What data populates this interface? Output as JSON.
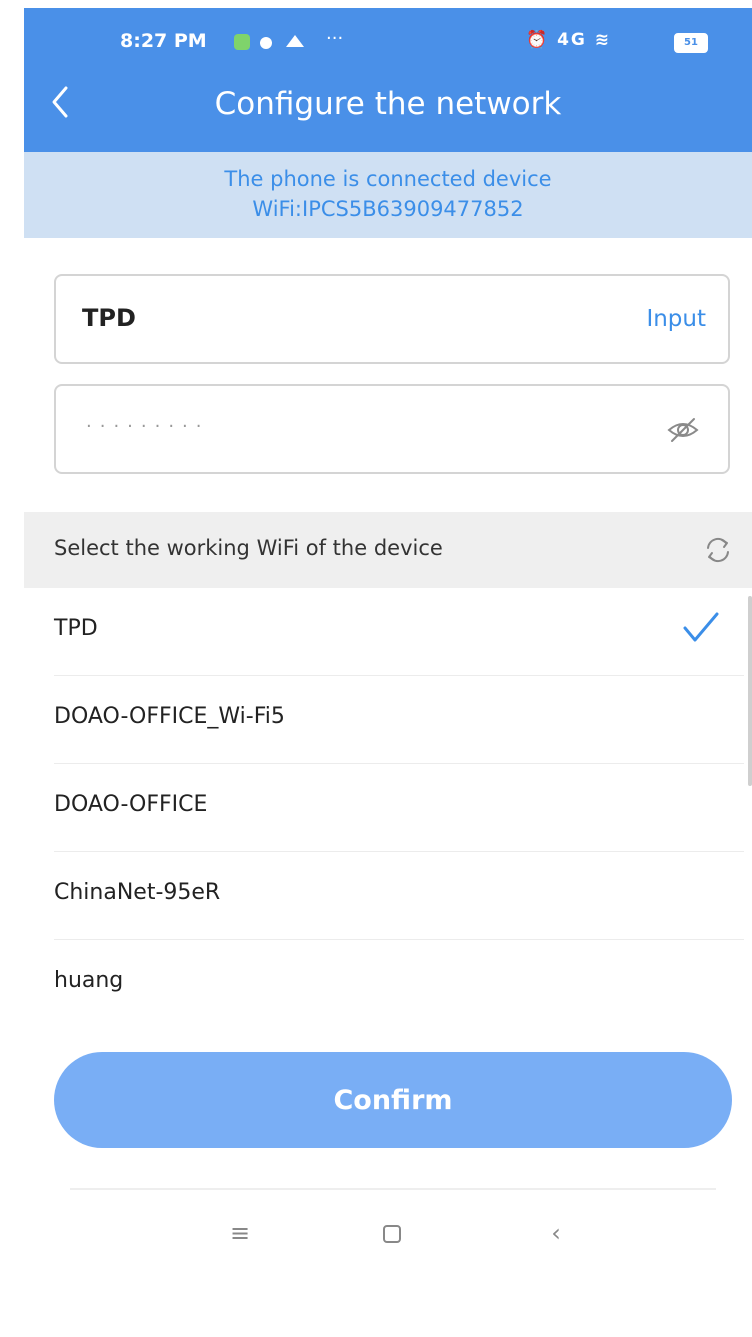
{
  "status_bar": {
    "time": "8:27 PM",
    "more": "···",
    "right_icons": "⏰ 4G ≋",
    "battery": "51"
  },
  "header": {
    "title": "Configure the network"
  },
  "banner": {
    "line1": "The phone is connected device",
    "line2": "WiFi:IPCS5B63909477852"
  },
  "form": {
    "ssid_value": "TPD",
    "ssid_action": "Input",
    "password_mask": "·········"
  },
  "wifi_section": {
    "label": "Select the working WiFi of the device"
  },
  "wifi_list": [
    {
      "name": "TPD",
      "selected": true
    },
    {
      "name": "DOAO-OFFICE_Wi-Fi5",
      "selected": false
    },
    {
      "name": "DOAO-OFFICE",
      "selected": false
    },
    {
      "name": "ChinaNet-95eR",
      "selected": false
    },
    {
      "name": "huang",
      "selected": false
    }
  ],
  "confirm": {
    "label": "Confirm"
  },
  "nav": {
    "menu": "≡",
    "back": "‹"
  },
  "colors": {
    "header": "#4a90e8",
    "banner_bg": "#cfe0f3",
    "accent": "#3b8ee8",
    "confirm": "#79aef5"
  }
}
